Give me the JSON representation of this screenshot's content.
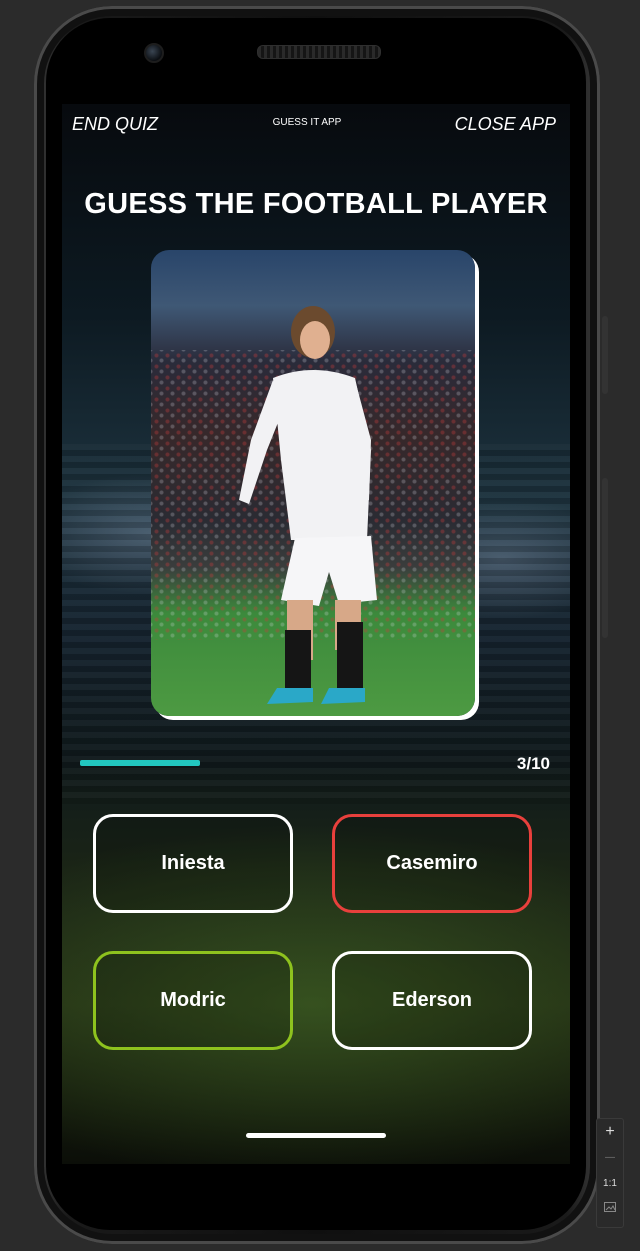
{
  "screen": {
    "end_quiz": "END QUIZ",
    "app_name": "GUESS IT APP",
    "close_app": "CLOSE APP",
    "title": "GUESS THE FOOTBALL PLAYER",
    "photo_alt": "football player photo",
    "progress": {
      "current": 3,
      "total": 10,
      "label": "3/10",
      "fraction": 0.3
    },
    "answers": [
      {
        "label": "Iniesta",
        "state": "neutral",
        "border_color": "#ffffff"
      },
      {
        "label": "Casemiro",
        "state": "wrong",
        "border_color": "#e8403c"
      },
      {
        "label": "Modric",
        "state": "correct",
        "border_color": "#8ec21e"
      },
      {
        "label": "Ederson",
        "state": "neutral",
        "border_color": "#ffffff"
      }
    ],
    "colors": {
      "progress": "#22c7c0",
      "text": "#ffffff"
    }
  },
  "emulator": {
    "zoom_in": "+",
    "zoom_out": "—",
    "actual_size": "1:1",
    "screenshot_icon": "screenshot-icon"
  }
}
